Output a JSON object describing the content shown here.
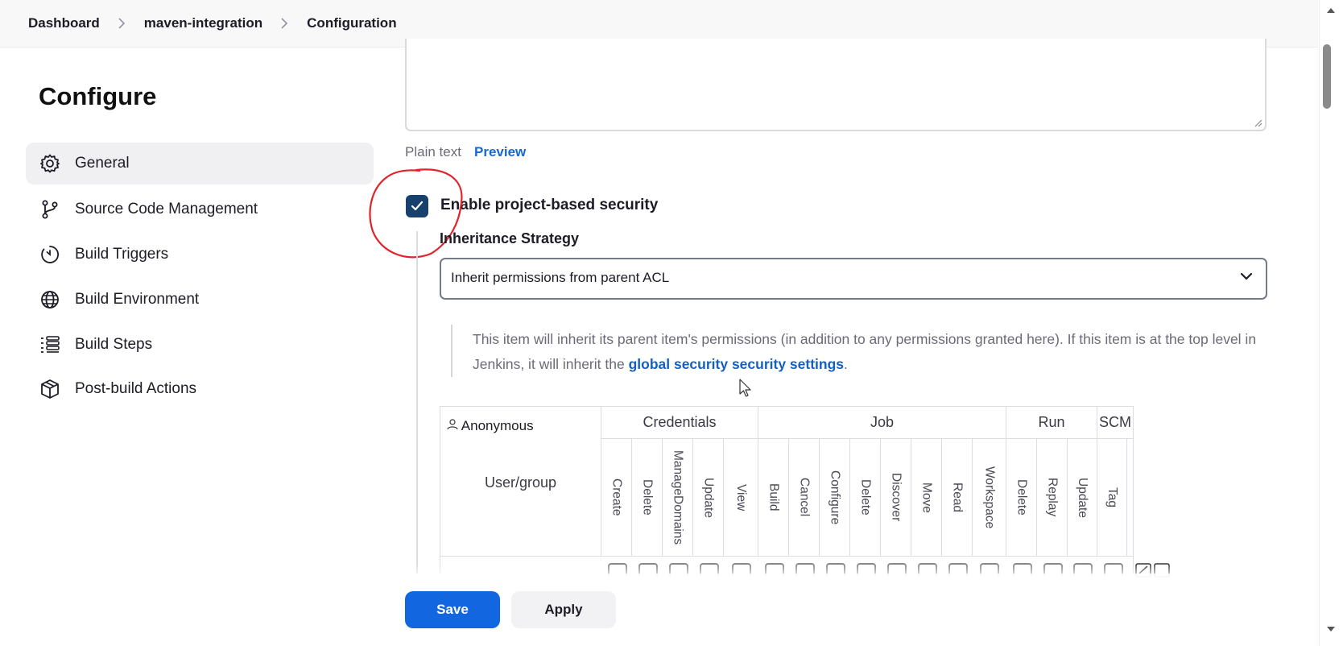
{
  "breadcrumb": {
    "items": [
      "Dashboard",
      "maven-integration",
      "Configuration"
    ]
  },
  "sidebar": {
    "title": "Configure",
    "items": [
      {
        "label": "General",
        "icon": "gear-icon",
        "active": true
      },
      {
        "label": "Source Code Management",
        "icon": "branch-icon"
      },
      {
        "label": "Build Triggers",
        "icon": "timer-icon"
      },
      {
        "label": "Build Environment",
        "icon": "globe-icon"
      },
      {
        "label": "Build Steps",
        "icon": "list-icon"
      },
      {
        "label": "Post-build Actions",
        "icon": "package-icon"
      }
    ]
  },
  "description": {
    "plain_text": "Plain text",
    "preview": "Preview"
  },
  "security": {
    "checkbox_label": "Enable project-based security",
    "checked": true,
    "inheritance_label": "Inheritance Strategy",
    "select_value": "Inherit permissions from parent ACL",
    "help_text": "This item will inherit its parent item's permissions (in addition to any permissions granted here). If this item is at the top level in Jenkins, it will inherit the",
    "help_link": "global security security settings",
    "help_suffix": "."
  },
  "matrix": {
    "user_group_header": "User/group",
    "groups": [
      "Credentials",
      "Job",
      "Run",
      "SCM"
    ],
    "permissions": [
      "Create",
      "Delete",
      "ManageDomains",
      "Update",
      "View",
      "Build",
      "Cancel",
      "Configure",
      "Delete",
      "Discover",
      "Move",
      "Read",
      "Workspace",
      "Delete",
      "Replay",
      "Update",
      "Tag"
    ],
    "rows": [
      {
        "name": "Anonymous"
      }
    ]
  },
  "buttons": {
    "save": "Save",
    "apply": "Apply"
  },
  "colors": {
    "save": "#1266e0",
    "checkbox": "#17406d",
    "link": "#1560bd",
    "annotation": "#e0242b"
  }
}
